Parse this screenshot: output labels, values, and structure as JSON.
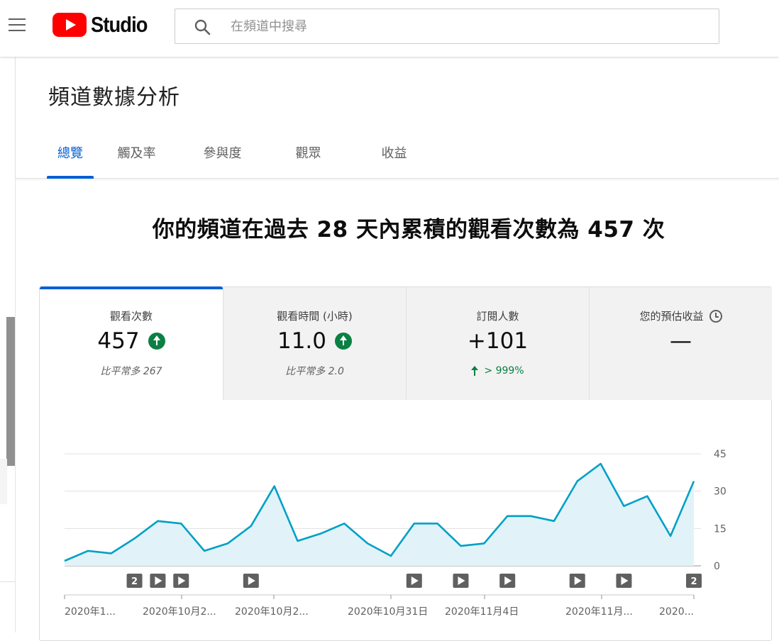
{
  "app": {
    "brand": "Studio"
  },
  "search": {
    "placeholder": "在頻道中搜尋"
  },
  "page": {
    "title": "頻道數據分析"
  },
  "tabs": [
    "總覽",
    "觸及率",
    "參與度",
    "觀眾",
    "收益"
  ],
  "headline": "你的頻道在過去 28 天內累積的觀看次數為 457 次",
  "metrics": {
    "views": {
      "label": "觀看次數",
      "value": "457",
      "sub": "比平常多 267"
    },
    "watch_time": {
      "label": "觀看時間 (小時)",
      "value": "11.0",
      "sub": "比平常多 2.0"
    },
    "subscribers": {
      "label": "訂閱人數",
      "value": "+101",
      "change": "> 999%"
    },
    "revenue": {
      "label": "您的預估收益",
      "value": "—"
    }
  },
  "chart_data": {
    "type": "area",
    "y_ticks": [
      "45",
      "30",
      "15",
      "0"
    ],
    "ylim": [
      0,
      45
    ],
    "x_labels": [
      "2020年1...",
      "2020年10月2...",
      "2020年10月2...",
      "2020年10月31日",
      "2020年11月4日",
      "2020年11月...",
      "2020..."
    ],
    "values": [
      2,
      6,
      5,
      11,
      18,
      17,
      6,
      9,
      16,
      32,
      10,
      13,
      17,
      9,
      4,
      17,
      17,
      8,
      9,
      20,
      20,
      18,
      34,
      41,
      24,
      28,
      12,
      34
    ],
    "color": "#00a0c7",
    "fill": "#e1f3f9",
    "markers": [
      {
        "index": 3,
        "type": "count",
        "label": "2"
      },
      {
        "index": 4,
        "type": "video"
      },
      {
        "index": 5,
        "type": "video"
      },
      {
        "index": 8,
        "type": "video"
      },
      {
        "index": 15,
        "type": "video"
      },
      {
        "index": 17,
        "type": "video"
      },
      {
        "index": 19,
        "type": "video"
      },
      {
        "index": 22,
        "type": "video"
      },
      {
        "index": 24,
        "type": "video"
      },
      {
        "index": 27,
        "type": "count",
        "label": "2"
      }
    ]
  }
}
